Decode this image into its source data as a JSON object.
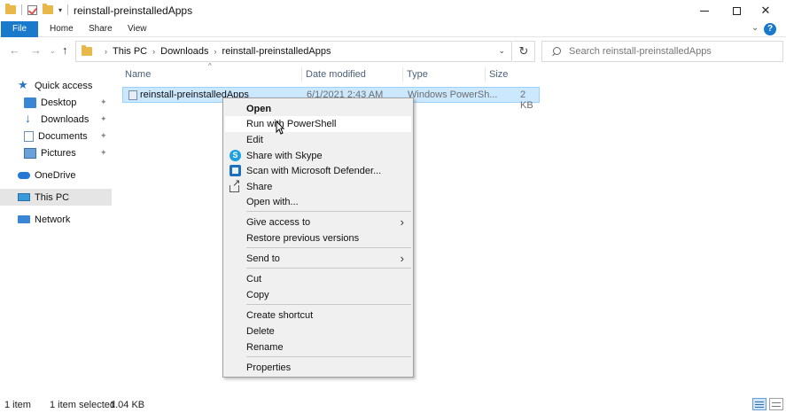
{
  "window": {
    "title": "reinstall-preinstalledApps"
  },
  "ribbon": {
    "tabs": [
      "File",
      "Home",
      "Share",
      "View"
    ]
  },
  "address": {
    "crumbs": [
      "This PC",
      "Downloads",
      "reinstall-preinstalledApps"
    ]
  },
  "search": {
    "placeholder": "Search reinstall-preinstalledApps"
  },
  "sidebar": {
    "items": [
      {
        "label": "Quick access",
        "icon": "star-icon"
      },
      {
        "label": "Desktop",
        "icon": "desktop-icon",
        "pinned": true
      },
      {
        "label": "Downloads",
        "icon": "downloads-icon",
        "pinned": true
      },
      {
        "label": "Documents",
        "icon": "documents-icon",
        "pinned": true
      },
      {
        "label": "Pictures",
        "icon": "pictures-icon",
        "pinned": true
      },
      {
        "label": "OneDrive",
        "icon": "onedrive-icon"
      },
      {
        "label": "This PC",
        "icon": "computer-icon",
        "selected": true
      },
      {
        "label": "Network",
        "icon": "network-icon"
      }
    ]
  },
  "columns": {
    "name": "Name",
    "date": "Date modified",
    "type": "Type",
    "size": "Size"
  },
  "files": [
    {
      "name": "reinstall-preinstalledApps",
      "date": "6/1/2021 2:43 AM",
      "type": "Windows PowerSh...",
      "size": "2 KB"
    }
  ],
  "context_menu": {
    "items": [
      {
        "label": "Open",
        "bold": true
      },
      {
        "label": "Run with PowerShell",
        "hover": true
      },
      {
        "label": "Edit"
      },
      {
        "label": "Share with Skype",
        "icon": "skype-icon"
      },
      {
        "label": "Scan with Microsoft Defender...",
        "icon": "defender-icon"
      },
      {
        "label": "Share",
        "icon": "share-icon"
      },
      {
        "label": "Open with..."
      },
      {
        "label": "Give access to",
        "submenu": true
      },
      {
        "label": "Restore previous versions"
      },
      {
        "label": "Send to",
        "submenu": true
      },
      {
        "label": "Cut"
      },
      {
        "label": "Copy"
      },
      {
        "label": "Create shortcut"
      },
      {
        "label": "Delete"
      },
      {
        "label": "Rename"
      },
      {
        "label": "Properties"
      }
    ]
  },
  "status": {
    "count": "1 item",
    "selected": "1 item selected",
    "size": "1.04 KB"
  },
  "colors": {
    "accent": "#1979ca",
    "selection": "#cce8ff",
    "selection_border": "#99d1ff",
    "menu_bg": "#f0f0f0"
  }
}
